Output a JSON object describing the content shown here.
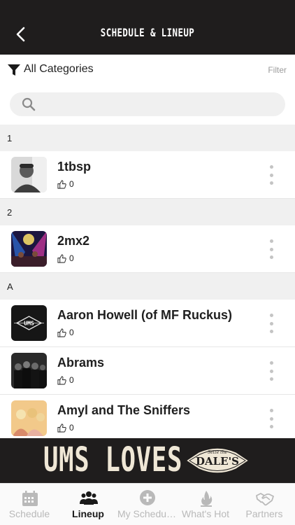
{
  "header": {
    "title": "SCHEDULE & LINEUP"
  },
  "filter": {
    "category": "All Categories",
    "filter_label": "Filter"
  },
  "search": {
    "placeholder": "",
    "value": ""
  },
  "sections": [
    {
      "letter": "1",
      "items": [
        {
          "name": "1tbsp",
          "likes": "0"
        }
      ]
    },
    {
      "letter": "2",
      "items": [
        {
          "name": "2mx2",
          "likes": "0"
        }
      ]
    },
    {
      "letter": "A",
      "items": [
        {
          "name": "Aaron Howell (of MF Ruckus)",
          "likes": "0"
        },
        {
          "name": "Abrams",
          "likes": "0"
        },
        {
          "name": "Amyl and The Sniffers",
          "likes": "0"
        }
      ]
    }
  ],
  "banner": {
    "text": "UMS LOVES",
    "logo_text": "DALE'S",
    "logo_top": "Seize the"
  },
  "tabs": [
    {
      "label": "Schedule",
      "icon": "calendar-icon",
      "active": false
    },
    {
      "label": "Lineup",
      "icon": "people-icon",
      "active": true
    },
    {
      "label": "My Schedu…",
      "icon": "plus-circle-icon",
      "active": false
    },
    {
      "label": "What's Hot",
      "icon": "flame-icon",
      "active": false
    },
    {
      "label": "Partners",
      "icon": "handshake-icon",
      "active": false
    }
  ],
  "colors": {
    "header_bg": "#1f1d1d",
    "section_bg": "#f0f0f0",
    "inactive_tab": "#b9b9b9",
    "active_tab": "#1a1a1a"
  }
}
